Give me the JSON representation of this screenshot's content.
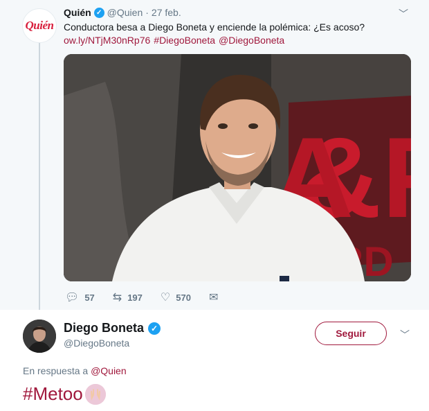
{
  "quoted_tweet": {
    "avatar_text": "Quién",
    "author_name": "Quién",
    "handle": "@Quien",
    "separator": "·",
    "date": "27 feb.",
    "text": "Conductora besa a Diego Boneta y enciende la polémica: ¿Es acoso?",
    "link": "ow.ly/NTjM30nRp76",
    "hashtag": "#DiegoBoneta",
    "mention": "@DiegoBoneta",
    "replies": "57",
    "retweets": "197",
    "likes": "570"
  },
  "tweet": {
    "author_name": "Diego Boneta",
    "handle": "@DiegoBoneta",
    "follow_label": "Seguir",
    "reply_prefix": "En respuesta a",
    "reply_handle": "@Quien",
    "text": "#Metoo"
  },
  "icons": {
    "verified": "verified-check-icon",
    "menu": "chevron-down-icon",
    "reply": "reply-icon",
    "retweet": "retweet-icon",
    "like": "heart-icon",
    "dm": "envelope-icon",
    "emoji": "raised-hands-emoji"
  },
  "colors": {
    "accent": "#a0183c",
    "verified": "#1da1f2",
    "muted": "#657786",
    "brand_red": "#d81e3c"
  }
}
